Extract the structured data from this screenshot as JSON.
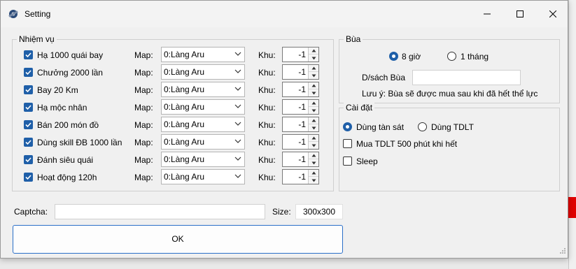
{
  "window": {
    "title": "Setting"
  },
  "tasks": {
    "legend": "Nhiệm vụ",
    "map_label": "Map:",
    "khu_label": "Khu:",
    "items": [
      {
        "label": "Hạ 1000 quái bay",
        "checked": true,
        "map": "0:Làng Aru",
        "khu": "-1"
      },
      {
        "label": "Chưởng 2000 lần",
        "checked": true,
        "map": "0:Làng Aru",
        "khu": "-1"
      },
      {
        "label": "Bay 20 Km",
        "checked": true,
        "map": "0:Làng Aru",
        "khu": "-1"
      },
      {
        "label": "Hạ mộc nhân",
        "checked": true,
        "map": "0:Làng Aru",
        "khu": "-1"
      },
      {
        "label": "Bán 200 món đồ",
        "checked": true,
        "map": "0:Làng Aru",
        "khu": "-1"
      },
      {
        "label": "Dùng skill ĐB 1000 lần",
        "checked": true,
        "map": "0:Làng Aru",
        "khu": "-1"
      },
      {
        "label": "Đánh siêu quái",
        "checked": true,
        "map": "0:Làng Aru",
        "khu": "-1"
      },
      {
        "label": "Hoạt động 120h",
        "checked": true,
        "map": "0:Làng Aru",
        "khu": "-1"
      }
    ]
  },
  "bua": {
    "legend": "Bùa",
    "option_8h": "8 giờ",
    "option_1month": "1 tháng",
    "selected": "8 giờ",
    "dsach_label": "D/sách Bùa",
    "dsach_value": "",
    "note": "Lưu ý: Bùa sẽ được mua sau khi đã hết thể lực"
  },
  "caidat": {
    "legend": "Cài đặt",
    "radio_tansat": "Dùng tàn sát",
    "radio_tdlt": "Dùng TDLT",
    "selected": "Dùng tàn sát",
    "check_mua_tdlt": "Mua TDLT 500 phút khi hết",
    "check_mua_tdlt_checked": false,
    "check_sleep": "Sleep",
    "check_sleep_checked": false
  },
  "captcha": {
    "label": "Captcha:",
    "value": ""
  },
  "size": {
    "label": "Size:",
    "value": "300x300"
  },
  "ok_button": "OK",
  "colors": {
    "accent": "#1f5fa8",
    "ok_border": "#2a6fc8",
    "background_red": "#e00000"
  }
}
